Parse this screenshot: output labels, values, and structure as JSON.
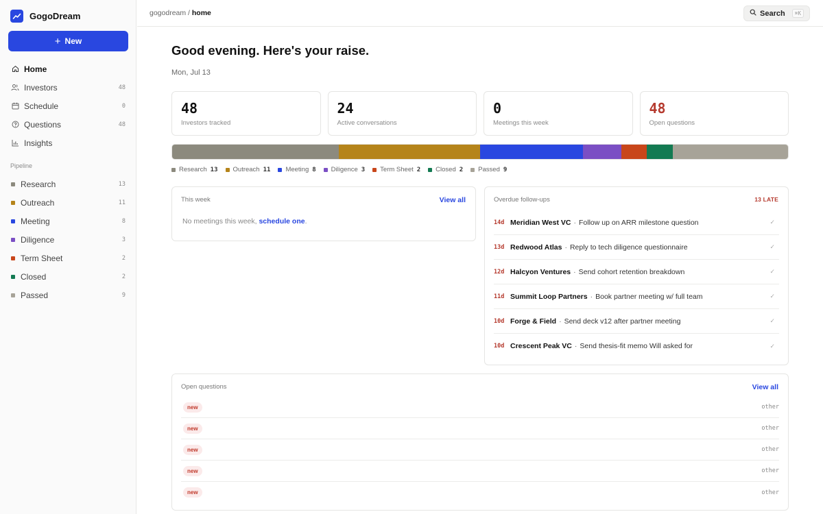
{
  "app": {
    "name": "GogoDream",
    "new_label": "New"
  },
  "nav": [
    {
      "id": "home",
      "label": "Home",
      "count": "",
      "icon": "home-icon",
      "active": true
    },
    {
      "id": "investors",
      "label": "Investors",
      "count": "48",
      "icon": "users-icon"
    },
    {
      "id": "schedule",
      "label": "Schedule",
      "count": "0",
      "icon": "calendar-icon"
    },
    {
      "id": "questions",
      "label": "Questions",
      "count": "48",
      "icon": "question-icon"
    },
    {
      "id": "insights",
      "label": "Insights",
      "count": "",
      "icon": "chart-icon"
    }
  ],
  "pipeline_title": "Pipeline",
  "pipeline": [
    {
      "label": "Research",
      "count": "13",
      "color": "#8c8a7e"
    },
    {
      "label": "Outreach",
      "count": "11",
      "color": "#b5841a"
    },
    {
      "label": "Meeting",
      "count": "8",
      "color": "#2947e0"
    },
    {
      "label": "Diligence",
      "count": "3",
      "color": "#7b4fc4"
    },
    {
      "label": "Term Sheet",
      "count": "2",
      "color": "#c8461a"
    },
    {
      "label": "Closed",
      "count": "2",
      "color": "#137a52"
    },
    {
      "label": "Passed",
      "count": "9",
      "color": "#a7a398"
    }
  ],
  "breadcrumb": {
    "root": "gogodream",
    "sep": " / ",
    "current": "home"
  },
  "search": {
    "label": "Search",
    "shortcut": "⌘K"
  },
  "greeting": "Good evening. Here's your raise.",
  "date": "Mon, Jul 13",
  "stats": [
    {
      "value": "48",
      "label": "Investors tracked",
      "alert": false
    },
    {
      "value": "24",
      "label": "Active conversations",
      "alert": false
    },
    {
      "value": "0",
      "label": "Meetings this week",
      "alert": false
    },
    {
      "value": "48",
      "label": "Open questions",
      "alert": true
    }
  ],
  "this_week": {
    "title": "This week",
    "view_all": "View all",
    "empty_text": "No meetings this week, ",
    "empty_link": "schedule one",
    "empty_end": "."
  },
  "overdue": {
    "title": "Overdue follow-ups",
    "late_label": "13 LATE",
    "items": [
      {
        "age": "14d",
        "investor": "Meridian West VC",
        "task": "Follow up on ARR milestone question"
      },
      {
        "age": "13d",
        "investor": "Redwood Atlas",
        "task": "Reply to tech diligence questionnaire"
      },
      {
        "age": "12d",
        "investor": "Halcyon Ventures",
        "task": "Send cohort retention breakdown"
      },
      {
        "age": "11d",
        "investor": "Summit Loop Partners",
        "task": "Book partner meeting w/ full team"
      },
      {
        "age": "10d",
        "investor": "Forge & Field",
        "task": "Send deck v12 after partner meeting"
      },
      {
        "age": "10d",
        "investor": "Crescent Peak VC",
        "task": "Send thesis-fit memo Will asked for"
      }
    ]
  },
  "open_questions": {
    "title": "Open questions",
    "view_all": "View all",
    "items": [
      {
        "badge": "new",
        "tag": "other"
      },
      {
        "badge": "new",
        "tag": "other"
      },
      {
        "badge": "new",
        "tag": "other"
      },
      {
        "badge": "new",
        "tag": "other"
      },
      {
        "badge": "new",
        "tag": "other"
      }
    ]
  }
}
